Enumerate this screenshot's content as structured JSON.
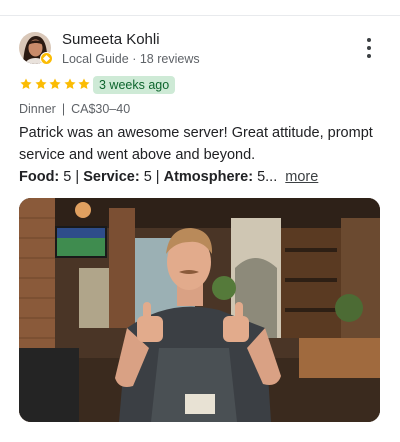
{
  "reviewer": {
    "name": "Sumeeta Kohli",
    "badge": "Local Guide",
    "separator": "·",
    "reviews": "18 reviews"
  },
  "review": {
    "rating": 5,
    "max_rating": 5,
    "time_ago": "3 weeks ago",
    "meal": "Dinner",
    "price": "CA$30–40",
    "text": "Patrick was an awesome server! Great attitude, prompt service and went above and beyond.",
    "food_label": "Food:",
    "food_value": "5",
    "service_label": "Service:",
    "service_value": "5",
    "atmosphere_label": "Atmosphere:",
    "atmosphere_value": "5...",
    "more_label": "more"
  },
  "colors": {
    "star": "#fbbc04",
    "time_badge_bg": "#ceead6",
    "time_badge_text": "#0d652d"
  },
  "icons": {
    "menu": "more-vert-icon",
    "badge": "local-guide-icon",
    "star": "star-icon"
  }
}
